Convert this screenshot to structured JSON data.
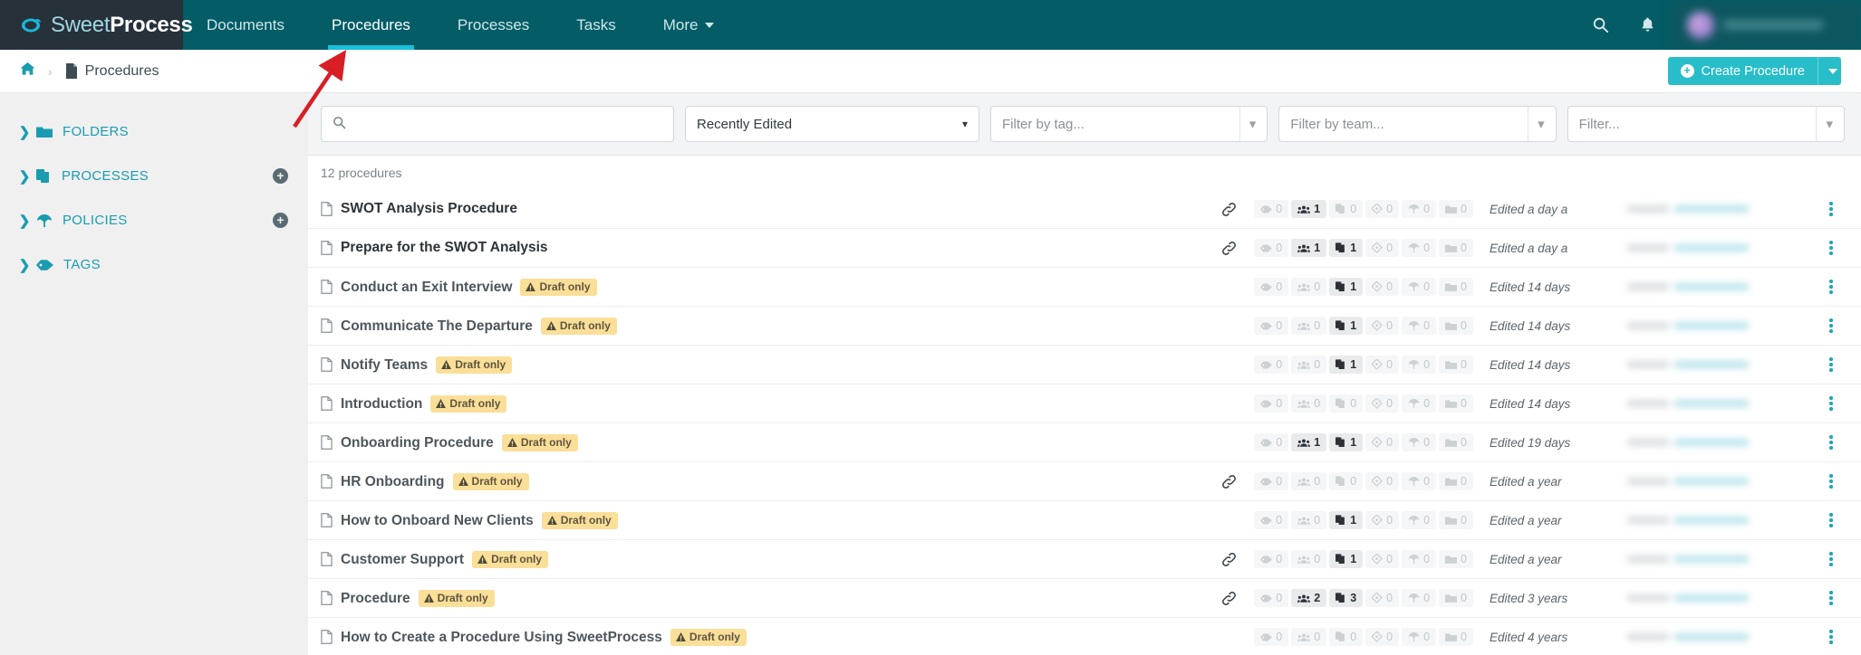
{
  "brand": {
    "light": "Sweet",
    "bold": "Process",
    "logo_icon": "sweetprocess-logo-icon"
  },
  "topnav": {
    "items": [
      {
        "label": "Documents",
        "active": false
      },
      {
        "label": "Procedures",
        "active": true
      },
      {
        "label": "Processes",
        "active": false
      },
      {
        "label": "Tasks",
        "active": false
      },
      {
        "label": "More",
        "active": false,
        "has_caret": true
      }
    ],
    "search_icon": "search-icon",
    "bell_icon": "bell-icon",
    "avatar_icon": "user-avatar"
  },
  "breadcrumb": {
    "home_icon": "home-icon",
    "separator": "›",
    "page_icon": "document-icon",
    "page_label": "Procedures"
  },
  "create_button": {
    "label": "Create Procedure",
    "plus": "+",
    "caret": "▾"
  },
  "sidebar": {
    "items": [
      {
        "label": "FOLDERS",
        "icon": "folder-icon",
        "chevron": "❯",
        "add": false
      },
      {
        "label": "PROCESSES",
        "icon": "processes-icon",
        "chevron": "❯",
        "add": true,
        "add_symbol": "+"
      },
      {
        "label": "POLICIES",
        "icon": "policy-icon",
        "chevron": "❯",
        "add": true,
        "add_symbol": "+"
      },
      {
        "label": "TAGS",
        "icon": "tag-icon",
        "chevron": "❯",
        "add": false
      }
    ]
  },
  "filters": {
    "search_placeholder": "",
    "search_value": "",
    "search_icon": "search-icon",
    "sort_value": "Recently Edited",
    "tag_placeholder": "Filter by tag...",
    "team_placeholder": "Filter by team...",
    "other_placeholder": "Filter...",
    "caret": "⌄"
  },
  "list": {
    "count_label": "12 procedures",
    "column_icons": [
      "tag-icon",
      "teams-icon",
      "processes-icon",
      "tasks-icon",
      "policy-icon",
      "folder-icon"
    ],
    "rows": [
      {
        "title": "SWOT Analysis Procedure",
        "draft": false,
        "link": true,
        "counts": [
          0,
          1,
          0,
          0,
          0,
          0
        ],
        "on": [
          false,
          true,
          false,
          false,
          false,
          false
        ],
        "edited": "Edited a day a"
      },
      {
        "title": "Prepare for the SWOT Analysis",
        "draft": false,
        "link": true,
        "counts": [
          0,
          1,
          1,
          0,
          0,
          0
        ],
        "on": [
          false,
          true,
          true,
          false,
          false,
          false
        ],
        "edited": "Edited a day a"
      },
      {
        "title": "Conduct an Exit Interview",
        "draft": true,
        "link": false,
        "counts": [
          0,
          0,
          1,
          0,
          0,
          0
        ],
        "on": [
          false,
          false,
          true,
          false,
          false,
          false
        ],
        "edited": "Edited 14 days"
      },
      {
        "title": "Communicate The Departure",
        "draft": true,
        "link": false,
        "counts": [
          0,
          0,
          1,
          0,
          0,
          0
        ],
        "on": [
          false,
          false,
          true,
          false,
          false,
          false
        ],
        "edited": "Edited 14 days"
      },
      {
        "title": "Notify Teams",
        "draft": true,
        "link": false,
        "counts": [
          0,
          0,
          1,
          0,
          0,
          0
        ],
        "on": [
          false,
          false,
          true,
          false,
          false,
          false
        ],
        "edited": "Edited 14 days"
      },
      {
        "title": "Introduction",
        "draft": true,
        "link": false,
        "counts": [
          0,
          0,
          0,
          0,
          0,
          0
        ],
        "on": [
          false,
          false,
          false,
          false,
          false,
          false
        ],
        "edited": "Edited 14 days"
      },
      {
        "title": "Onboarding Procedure",
        "draft": true,
        "link": false,
        "counts": [
          0,
          1,
          1,
          0,
          0,
          0
        ],
        "on": [
          false,
          true,
          true,
          false,
          false,
          false
        ],
        "edited": "Edited 19 days"
      },
      {
        "title": "HR Onboarding",
        "draft": true,
        "link": true,
        "counts": [
          0,
          0,
          0,
          0,
          0,
          0
        ],
        "on": [
          false,
          false,
          false,
          false,
          false,
          false
        ],
        "edited": "Edited a year"
      },
      {
        "title": "How to Onboard New Clients",
        "draft": true,
        "link": false,
        "counts": [
          0,
          0,
          1,
          0,
          0,
          0
        ],
        "on": [
          false,
          false,
          true,
          false,
          false,
          false
        ],
        "edited": "Edited a year"
      },
      {
        "title": "Customer Support",
        "draft": true,
        "link": true,
        "counts": [
          0,
          0,
          1,
          0,
          0,
          0
        ],
        "on": [
          false,
          false,
          true,
          false,
          false,
          false
        ],
        "edited": "Edited a year"
      },
      {
        "title": "Procedure",
        "draft": true,
        "link": true,
        "counts": [
          0,
          2,
          3,
          0,
          0,
          0
        ],
        "on": [
          false,
          true,
          true,
          false,
          false,
          false
        ],
        "edited": "Edited 3 years"
      },
      {
        "title": "How to Create a Procedure Using SweetProcess",
        "draft": true,
        "link": false,
        "counts": [
          0,
          0,
          0,
          0,
          0,
          0
        ],
        "on": [
          false,
          false,
          false,
          false,
          false,
          false
        ],
        "edited": "Edited 4 years"
      }
    ],
    "draft_badge": {
      "label": "Draft only",
      "icon": "warning-triangle-icon"
    },
    "link_icon": "link-icon",
    "kebab_icon": "more-vertical-icon"
  },
  "annotation": {
    "type": "red-arrow",
    "points_to": "procedures-tab",
    "color": "#d81f26"
  },
  "colors": {
    "nav_bg": "#035c66",
    "brand_bg": "#27313a",
    "accent_teal": "#17c1dd",
    "button_teal": "#27bdc9",
    "sidebar_link": "#1a9cb0",
    "draft_badge": "#fadf98"
  }
}
